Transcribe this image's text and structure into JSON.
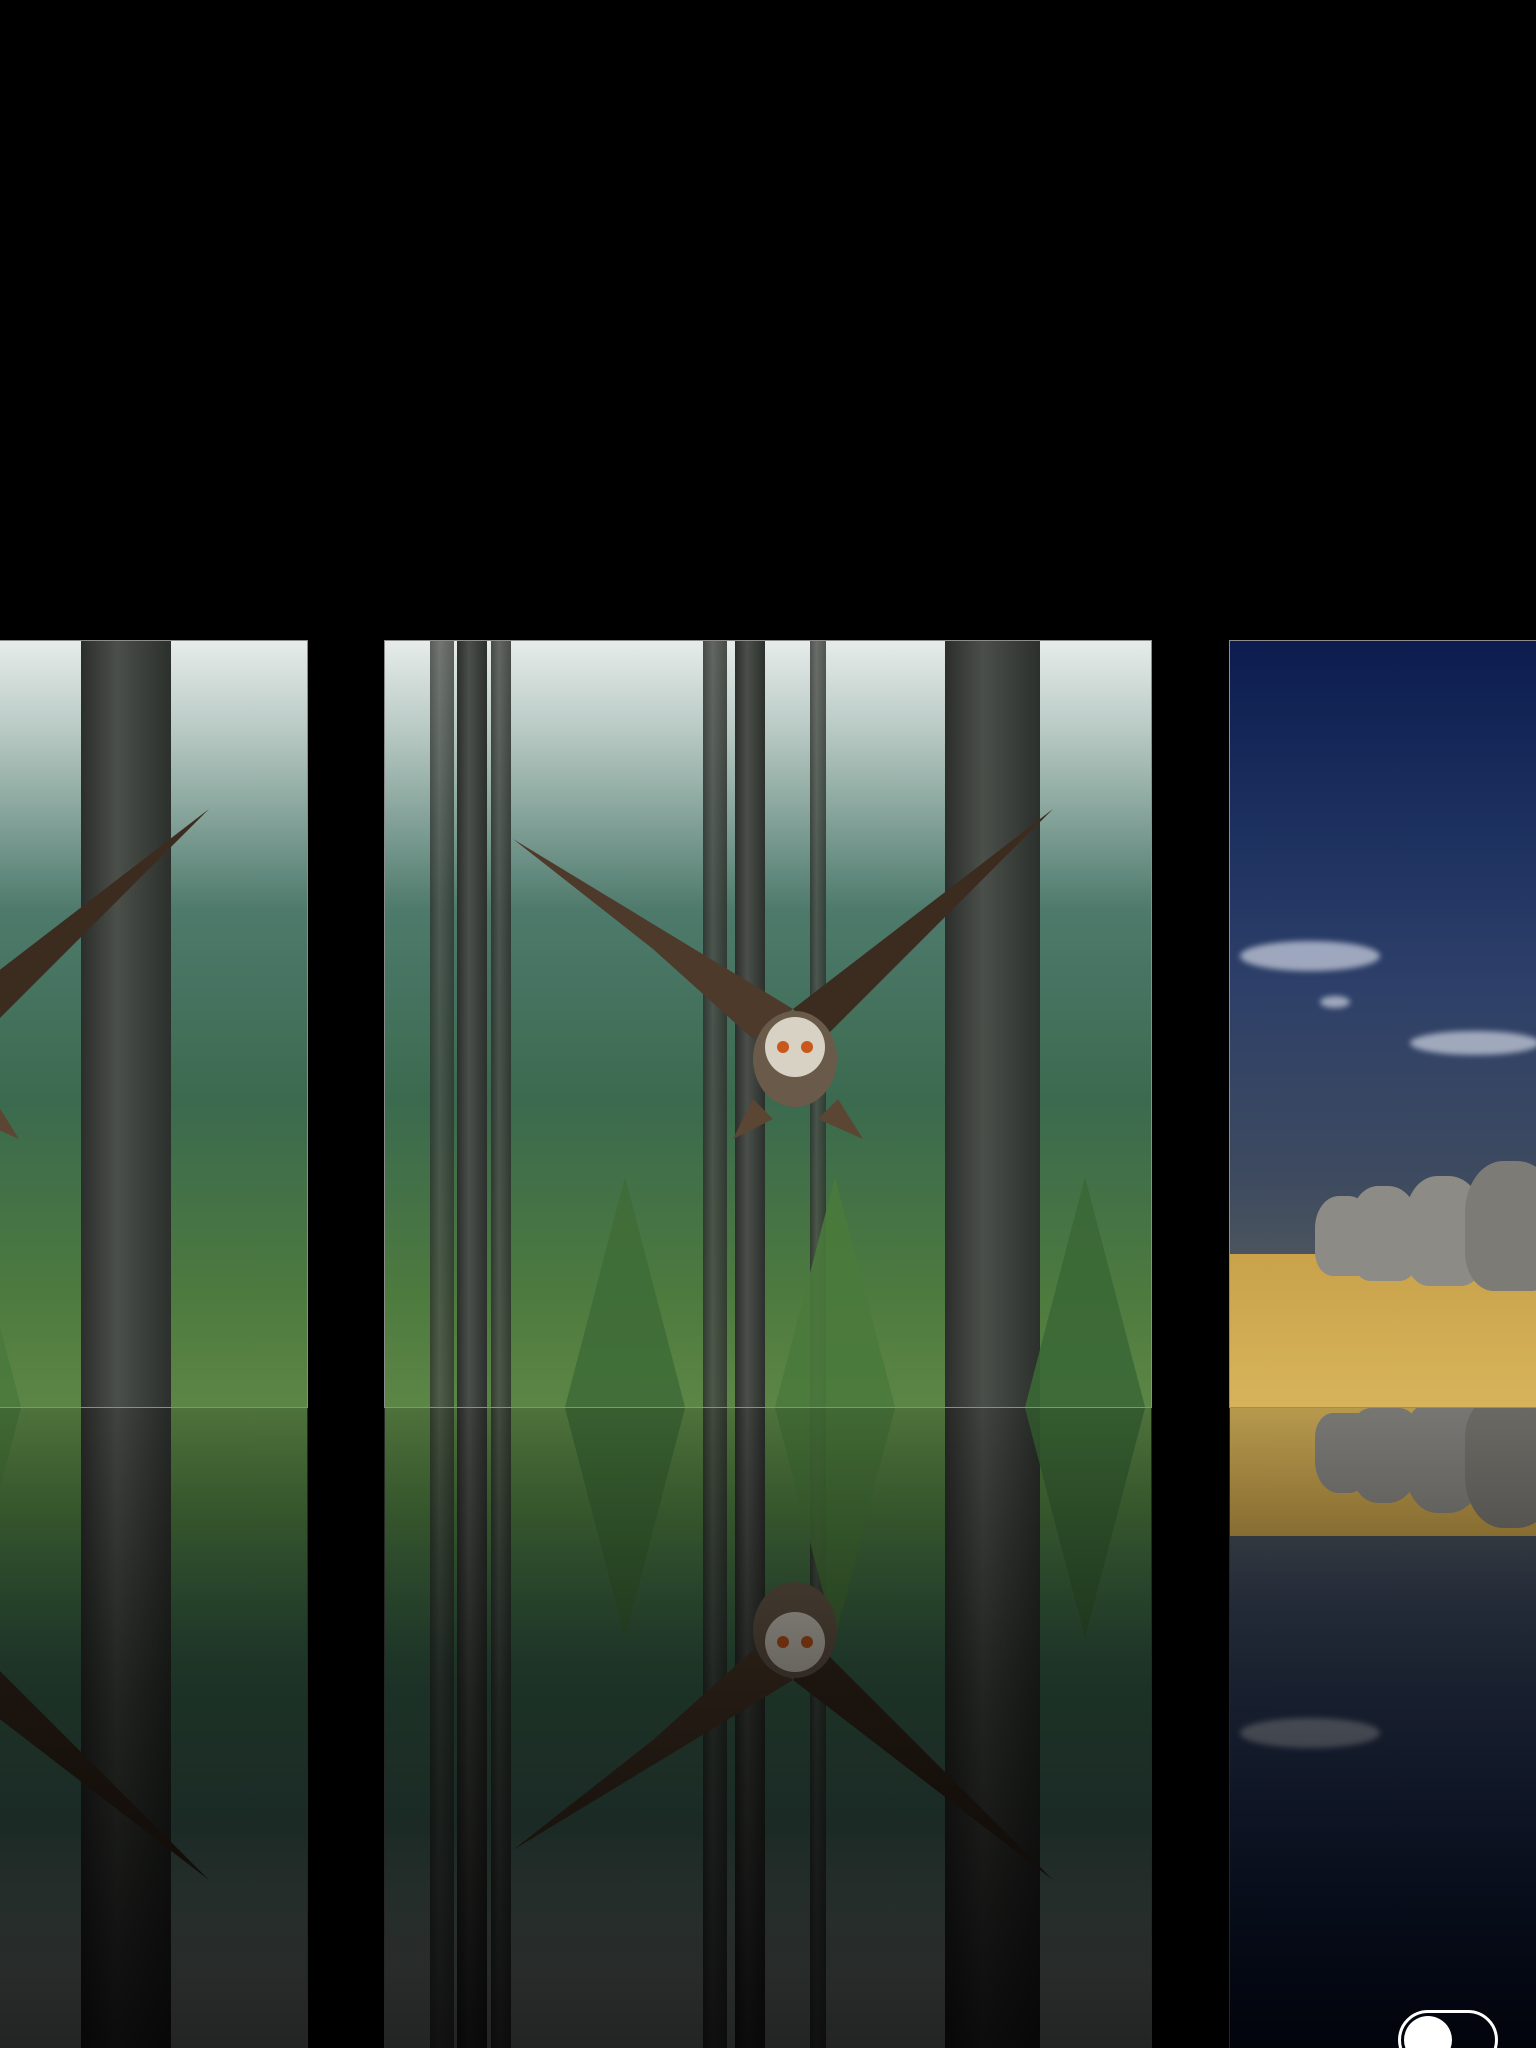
{
  "gallery": {
    "cards": [
      {
        "id": "left",
        "scene": "forest",
        "subject": "owl-in-flight"
      },
      {
        "id": "center",
        "scene": "forest",
        "subject": "owl-in-flight"
      },
      {
        "id": "right",
        "scene": "savanna",
        "subject": "elephant-herd"
      }
    ],
    "reflection_toggle": {
      "state": "off",
      "icon": "toggle-switch-icon"
    }
  },
  "colors": {
    "background": "#000000",
    "frame": "#ffffff",
    "toggle": "#ffffff"
  }
}
